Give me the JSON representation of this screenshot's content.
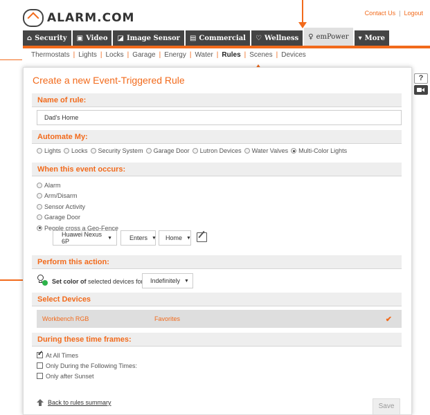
{
  "brand": {
    "logo_text": "ALARM.COM"
  },
  "top_links": {
    "contact": "Contact Us",
    "separator": "|",
    "logout": "Logout"
  },
  "tabs": [
    {
      "label": "Security",
      "icon": "home-icon"
    },
    {
      "label": "Video",
      "icon": "video-icon"
    },
    {
      "label": "Image Sensor",
      "icon": "camera-icon"
    },
    {
      "label": "Commercial",
      "icon": "building-icon"
    },
    {
      "label": "Wellness",
      "icon": "heart-icon"
    },
    {
      "label": "emPower",
      "icon": "bulb-icon",
      "active": true
    },
    {
      "label": "More",
      "icon": "caret-down-icon"
    }
  ],
  "subnav": [
    "Thermostats",
    "Lights",
    "Locks",
    "Garage",
    "Energy",
    "Water",
    "Rules",
    "Scenes",
    "Devices"
  ],
  "page_title": "Create a new Event-Triggered Rule",
  "sections": {
    "name_of_rule": "Name of rule:",
    "automate_my": "Automate My:",
    "when_event": "When this event occurs:",
    "perform_action": "Perform this action:",
    "select_devices": "Select Devices",
    "time_frames": "During these time frames:"
  },
  "rule_name_value": "Dad's Home",
  "automate_options": [
    {
      "label": "Lights",
      "selected": false
    },
    {
      "label": "Locks",
      "selected": false
    },
    {
      "label": "Security System",
      "selected": false
    },
    {
      "label": "Garage Door",
      "selected": false
    },
    {
      "label": "Lutron Devices",
      "selected": false
    },
    {
      "label": "Water Valves",
      "selected": false
    },
    {
      "label": "Multi-Color Lights",
      "selected": true
    }
  ],
  "event_options": [
    {
      "label": "Alarm",
      "selected": false
    },
    {
      "label": "Arm/Disarm",
      "selected": false
    },
    {
      "label": "Sensor Activity",
      "selected": false
    },
    {
      "label": "Garage Door",
      "selected": false
    },
    {
      "label": "People cross a Geo-Fence",
      "selected": true
    }
  ],
  "geofence": {
    "device": "Huawei Nexus 6P",
    "direction": "Enters",
    "location": "Home"
  },
  "action": {
    "bold": "Set color of",
    "rest": "selected devices for",
    "duration": "Indefinitely"
  },
  "device": {
    "name": "Workbench RGB",
    "group": "Favorites",
    "check": "✔"
  },
  "time_options": [
    {
      "label": "At All Times",
      "checked": true
    },
    {
      "label": "Only During the Following Times:",
      "checked": false
    },
    {
      "label": "Only after Sunset",
      "checked": false
    }
  ],
  "back_link": "Back to rules summary",
  "save_label": "Save",
  "colors": {
    "accent": "#f26a1b",
    "tab_dark": "#444444",
    "bulb_green": "#2db34a"
  }
}
